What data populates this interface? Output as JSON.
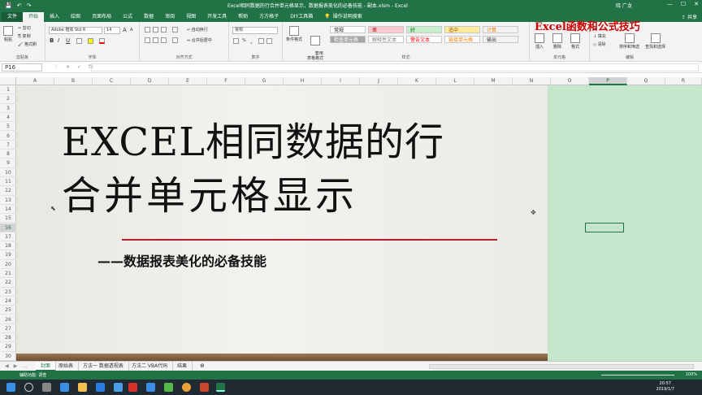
{
  "window": {
    "title": "Excel相同数据的行合并单元格显示，数据报表美化的必备技能 - 副本.xlsm  -  Excel",
    "user": "晓 广龙",
    "quick_access": [
      "💾",
      "↶",
      "↷"
    ]
  },
  "ribbon_tabs": [
    "文件",
    "开始",
    "插入",
    "绘图",
    "页面布局",
    "公式",
    "数据",
    "审阅",
    "视图",
    "开发工具",
    "帮助",
    "方方格子",
    "DIY工具箱",
    "操作说明搜索"
  ],
  "share": "共享",
  "clipboard": {
    "cut": "剪切",
    "copy": "复制",
    "paint": "格式刷",
    "paste": "粘贴",
    "label": "剪贴板"
  },
  "font": {
    "name": "Adobe 楷体 Std R",
    "size": "14",
    "grow": "A",
    "shrink": "A",
    "bold": "B",
    "italic": "I",
    "underline": "U",
    "label": "字体"
  },
  "alignment": {
    "wrap": "自动换行",
    "merge": "合并后居中",
    "label": "对齐方式"
  },
  "number": {
    "format": "常规",
    "percent": "%",
    "comma": ",",
    "label": "数字"
  },
  "styles": {
    "conditional": "条件格式",
    "table": "套用\n表格格式",
    "cells": [
      {
        "text": "常规",
        "bg": "#ffffff",
        "fg": "#222222"
      },
      {
        "text": "差",
        "bg": "#ffc7ce",
        "fg": "#9c0006"
      },
      {
        "text": "好",
        "bg": "#c6efce",
        "fg": "#006100"
      },
      {
        "text": "适中",
        "bg": "#ffeb9c",
        "fg": "#9c5700"
      },
      {
        "text": "计算",
        "bg": "#f2f2f2",
        "fg": "#fa7d00"
      },
      {
        "text": "检查单元格",
        "bg": "#a5a5a5",
        "fg": "#ffffff"
      },
      {
        "text": "解释性文本",
        "bg": "#ffffff",
        "fg": "#7f7f7f"
      },
      {
        "text": "警告文本",
        "bg": "#ffffff",
        "fg": "#ff0000"
      },
      {
        "text": "链接单元格",
        "bg": "#ffffff",
        "fg": "#fa7d00"
      },
      {
        "text": "输出",
        "bg": "#f2f2f2",
        "fg": "#3f3f3f"
      }
    ],
    "label": "样式"
  },
  "cells_group": {
    "insert": "插入",
    "delete": "删除",
    "format": "格式",
    "label": "单元格"
  },
  "editing": {
    "sum": "Σ",
    "fill": "填充",
    "clear": "清除",
    "sort": "排序和筛选",
    "find": "查找和选择",
    "label": "编辑"
  },
  "watermark": "Excel函数和公式技巧",
  "formula_bar": {
    "cell_ref": "P16",
    "icons": [
      "⋮",
      "✕",
      "✓",
      "fx"
    ],
    "value": ""
  },
  "columns": [
    "A",
    "B",
    "C",
    "D",
    "E",
    "F",
    "G",
    "H",
    "I",
    "J",
    "K",
    "L",
    "M",
    "N",
    "O",
    "P",
    "Q",
    "R"
  ],
  "selected_column": "P",
  "rows": [
    "1",
    "2",
    "3",
    "4",
    "5",
    "6",
    "7",
    "8",
    "9",
    "10",
    "11",
    "12",
    "13",
    "14",
    "15",
    "16",
    "17",
    "18",
    "19",
    "20",
    "21",
    "22",
    "23",
    "24",
    "25",
    "26",
    "27",
    "28",
    "29",
    "30"
  ],
  "selected_row": "16",
  "banner": {
    "line1": "EXCEL相同数据的行",
    "line2": "合并单元格显示",
    "subtitle": "——数据报表美化的必备技能"
  },
  "sheet_nav": [
    "◀",
    "▶",
    "…"
  ],
  "sheets": [
    "封面",
    "原始表",
    "方法一 数据透视表",
    "方法二 VBA代码",
    "结果"
  ],
  "active_sheet": "封面",
  "add_sheet": "⊕",
  "status": {
    "message": "辅助功能: 调查",
    "zoom": "100%"
  },
  "taskbar": {
    "time": "20:57",
    "date": "2019/1/7"
  },
  "colors": {
    "excel_green": "#217346",
    "banner_red": "#b51e2d",
    "sheet_bg": "#c6e6cb"
  }
}
